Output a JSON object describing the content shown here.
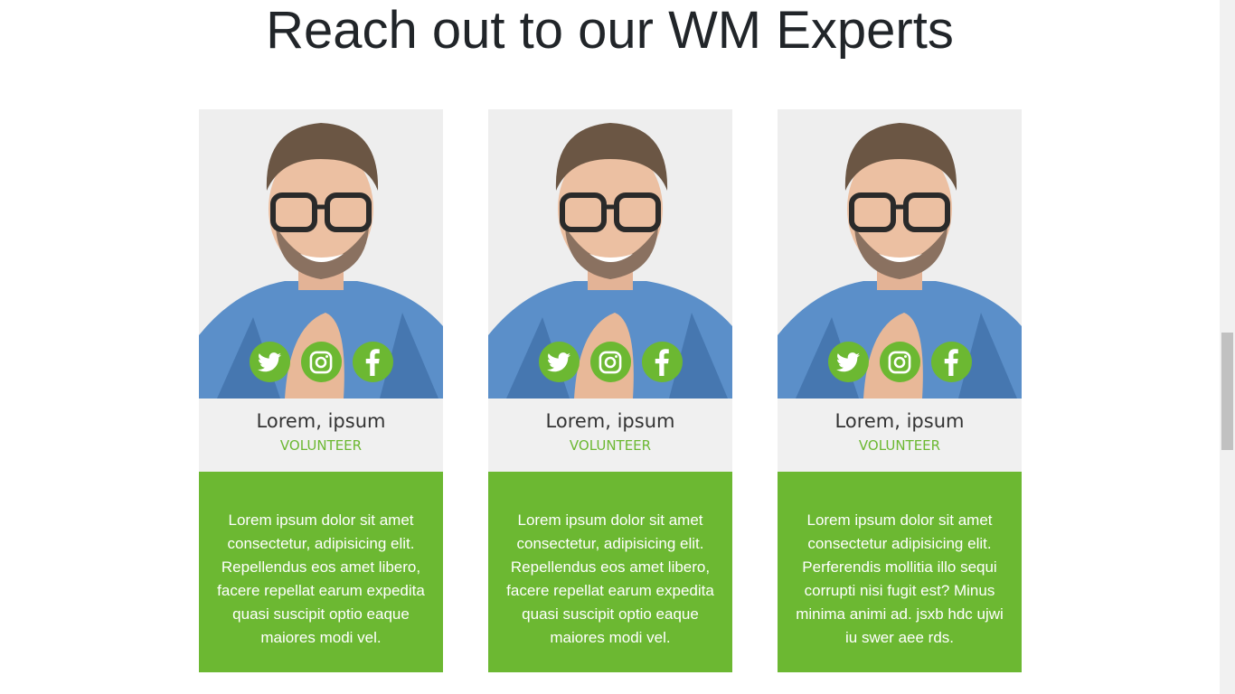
{
  "section": {
    "heading": "Reach out to our WM Experts"
  },
  "colors": {
    "accent": "#6cb832",
    "info_bg": "#f0f0f0",
    "heading": "#212529"
  },
  "cards": [
    {
      "name": "Lorem, ipsum",
      "role": "VOLUNTEER",
      "description": "Lorem ipsum dolor sit amet consectetur, adipisicing elit. Repellendus eos amet libero, facere repellat earum expedita quasi suscipit optio eaque maiores modi vel.",
      "socials": [
        "twitter-icon",
        "instagram-icon",
        "facebook-icon"
      ]
    },
    {
      "name": "Lorem, ipsum",
      "role": "VOLUNTEER",
      "description": "Lorem ipsum dolor sit amet consectetur, adipisicing elit. Repellendus eos amet libero, facere repellat earum expedita quasi suscipit optio eaque maiores modi vel.",
      "socials": [
        "twitter-icon",
        "instagram-icon",
        "facebook-icon"
      ]
    },
    {
      "name": "Lorem, ipsum",
      "role": "VOLUNTEER",
      "description": "Lorem ipsum dolor sit amet consectetur adipisicing elit. Perferendis mollitia illo sequi corrupti nisi fugit est? Minus minima animi ad. jsxb hdc ujwi iu swer aee rds.",
      "socials": [
        "twitter-icon",
        "instagram-icon",
        "facebook-icon"
      ]
    }
  ]
}
